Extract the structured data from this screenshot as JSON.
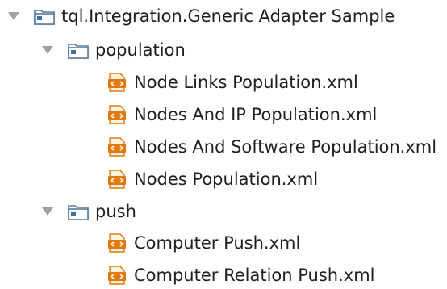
{
  "tree": {
    "project": {
      "label": "tql.Integration.Generic Adapter Sample",
      "toggle_icon": "expanded-triangle-icon",
      "icon": "project-folder-icon"
    },
    "folders": [
      {
        "label": "population",
        "toggle_icon": "expanded-triangle-icon",
        "icon": "folder-icon",
        "files": [
          {
            "label": "Node Links Population.xml",
            "icon": "xml-file-icon"
          },
          {
            "label": "Nodes And IP Population.xml",
            "icon": "xml-file-icon"
          },
          {
            "label": "Nodes And Software Population.xml",
            "icon": "xml-file-icon"
          },
          {
            "label": "Nodes Population.xml",
            "icon": "xml-file-icon"
          }
        ]
      },
      {
        "label": "push",
        "toggle_icon": "expanded-triangle-icon",
        "icon": "folder-icon",
        "files": [
          {
            "label": "Computer Push.xml",
            "icon": "xml-file-icon"
          },
          {
            "label": "Computer Relation Push.xml",
            "icon": "xml-file-icon"
          }
        ]
      }
    ]
  },
  "colors": {
    "text": "#1e1e1e",
    "triangle": "#a0a0a0",
    "folder": "#5a7a9a",
    "folder_fill": "#ffffff",
    "xml_orange": "#e07a10",
    "xml_bg": "#f6c77c"
  }
}
